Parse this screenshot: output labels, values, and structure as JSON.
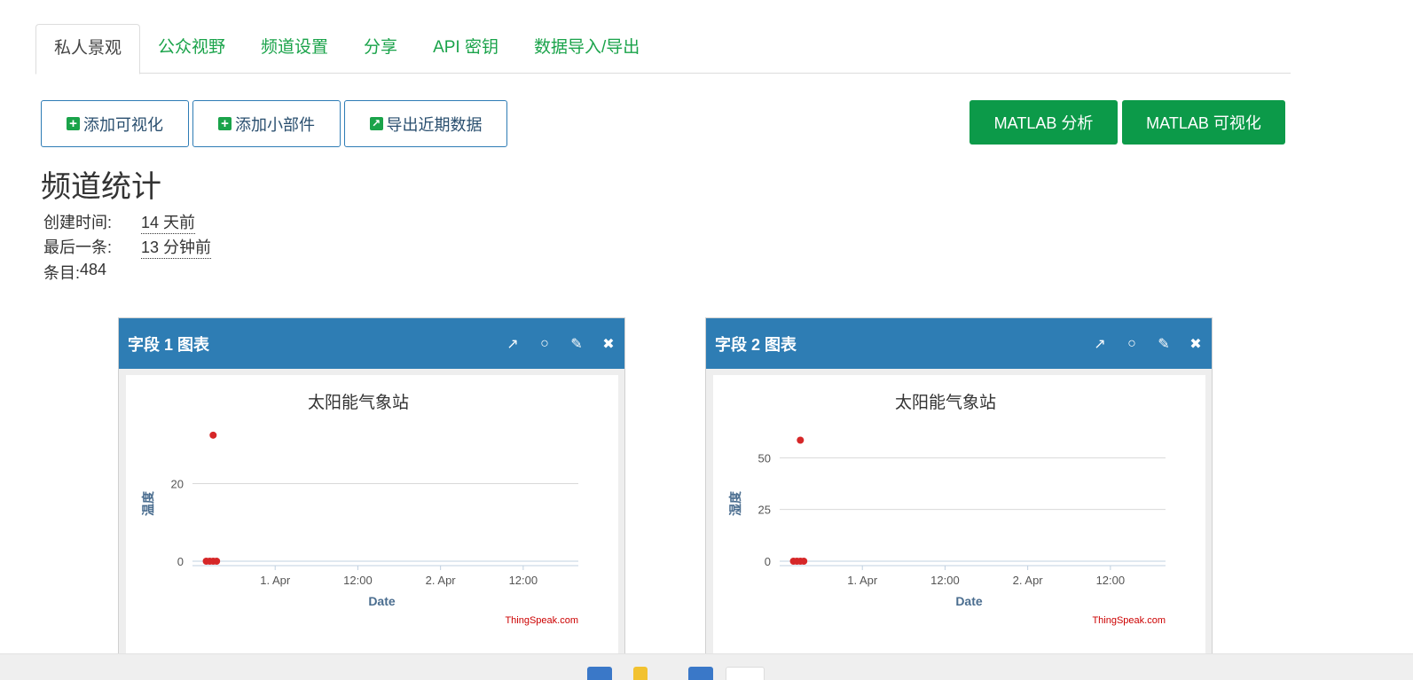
{
  "tabs": [
    {
      "label": "私人景观",
      "active": true
    },
    {
      "label": "公众视野",
      "active": false
    },
    {
      "label": "频道设置",
      "active": false
    },
    {
      "label": "分享",
      "active": false
    },
    {
      "label": "API 密钥",
      "active": false
    },
    {
      "label": "数据导入/导出",
      "active": false
    }
  ],
  "toolbar": {
    "add_visualization": "添加可视化",
    "add_widget": "添加小部件",
    "export_recent": "导出近期数据",
    "matlab_analysis": "MATLAB 分析",
    "matlab_visualization": "MATLAB 可视化"
  },
  "stats": {
    "title": "频道统计",
    "created_label": "创建时间:",
    "created_value": "14 天前",
    "last_entry_label": "最后一条:",
    "last_entry_value": "13 分钟前",
    "entries_label": "条目:",
    "entries_value": "484"
  },
  "panels": [
    {
      "title": "字段 1 图表"
    },
    {
      "title": "字段 2 图表"
    }
  ],
  "colors": {
    "accent_green": "#0c9a49",
    "link_green": "#1aa34a",
    "panel_blue": "#2e7db4",
    "point_red": "#d62728"
  },
  "chart_data": [
    {
      "type": "scatter",
      "title": "太阳能气象站",
      "xlabel": "Date",
      "ylabel": "温度",
      "x_tick_labels": [
        "1. Apr",
        "12:00",
        "2. Apr",
        "12:00"
      ],
      "y_ticks": [
        0,
        20
      ],
      "ylim": [
        0,
        32
      ],
      "credit": "ThingSpeak.com",
      "series": [
        {
          "x": [
            "2024-03-31 14:00",
            "2024-03-31 14:30",
            "2024-03-31 15:00",
            "2024-03-31 15:30",
            "2024-03-31 15:00"
          ],
          "y": [
            0,
            0,
            0,
            0,
            32.5
          ]
        }
      ]
    },
    {
      "type": "scatter",
      "title": "太阳能气象站",
      "xlabel": "Date",
      "ylabel": "湿度",
      "x_tick_labels": [
        "1. Apr",
        "12:00",
        "2. Apr",
        "12:00"
      ],
      "y_ticks": [
        0,
        25,
        50
      ],
      "ylim": [
        0,
        60
      ],
      "credit": "ThingSpeak.com",
      "series": [
        {
          "x": [
            "2024-03-31 14:00",
            "2024-03-31 14:30",
            "2024-03-31 15:00",
            "2024-03-31 15:30",
            "2024-03-31 15:00"
          ],
          "y": [
            0,
            0,
            0,
            0,
            58.5
          ]
        }
      ]
    }
  ]
}
